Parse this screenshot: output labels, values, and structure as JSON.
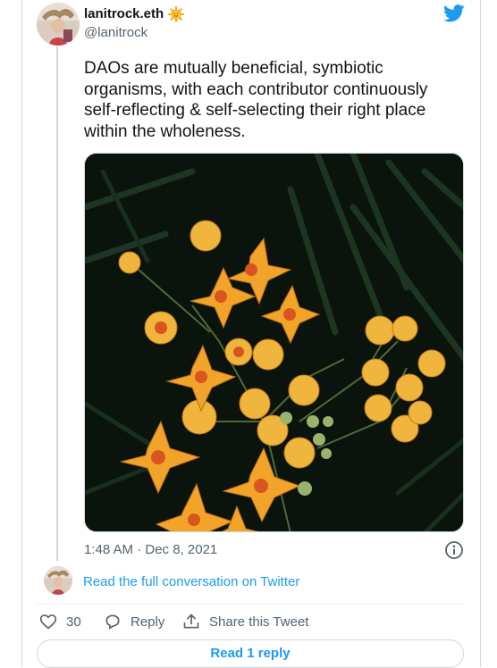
{
  "tweet": {
    "display_name": "lanitrock.eth",
    "handle": "@lanitrock",
    "text": "DAOs are mutually beneficial, symbiotic organisms, with each contributor continuously self-reflecting & self-selecting their right place within the wholeness.",
    "timestamp": "1:48 AM · Dec 8, 2021",
    "likes": "30",
    "reply_label": "Reply",
    "share_label": "Share this Tweet",
    "read_conversation_label": "Read the full conversation on Twitter",
    "read_replies_label": "Read 1 reply"
  },
  "icons": {
    "badge": "sun-emoji-icon",
    "brand": "twitter-bird-icon",
    "info": "info-icon",
    "like": "heart-icon",
    "reply": "speech-bubble-icon",
    "share": "share-upload-icon"
  },
  "colors": {
    "accent": "#1d9bf0",
    "text": "#0f1419",
    "secondary": "#536471",
    "border": "#cfd9de",
    "flower": "#f2a42a"
  }
}
